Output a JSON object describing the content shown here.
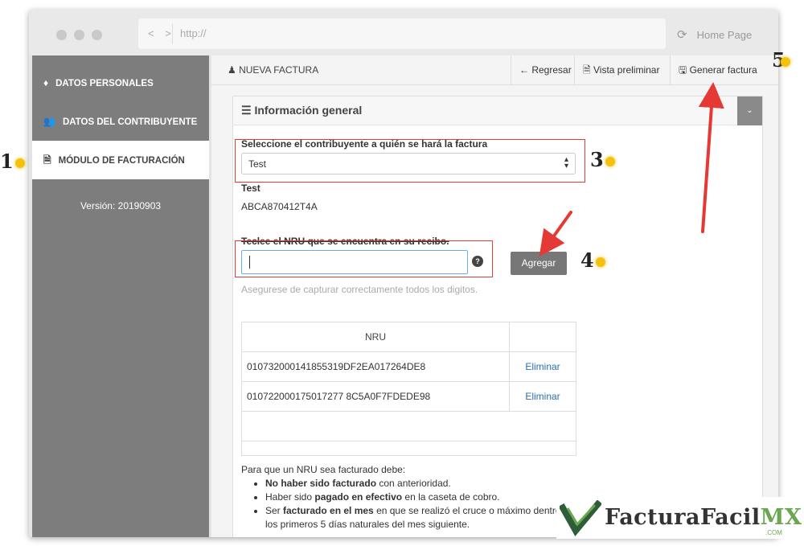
{
  "browser": {
    "url": "http://",
    "nav_arrows": "< >",
    "home_label": "Home Page",
    "reload_icon": "⟳"
  },
  "sidebar": {
    "items": [
      {
        "label": "DATOS PERSONALES",
        "icon": "person-icon",
        "glyph": "♦",
        "active": false
      },
      {
        "label": "DATOS DEL CONTRIBUYENTE",
        "icon": "group-icon",
        "glyph": "👥",
        "active": false
      },
      {
        "label": "MÓDULO DE FACTURACIÓN",
        "icon": "document-icon",
        "glyph": "🗎",
        "active": true
      }
    ],
    "version": "Versión: 20190903"
  },
  "topbar": {
    "breadcrumb": "NUEVA FACTURA",
    "back_label": "Regresar",
    "back_icon": "←",
    "preview_label": "Vista preliminar",
    "preview_icon": "🗎",
    "generate_label": "Generar factura",
    "generate_icon": "🖫"
  },
  "panel": {
    "title": "Información general",
    "menu_icon": "☰",
    "collapse_icon": "⌄"
  },
  "form": {
    "select_label": "Seleccione el contribuyente a quién se hará la factura",
    "select_value": "Test",
    "taxpayer_name": "Test",
    "taxpayer_rfc": "ABCA870412T4A",
    "nru_label": "Teclee el NRU que se encuentra en su recibo.",
    "nru_value": "",
    "help_glyph": "?",
    "add_button": "Agregar",
    "hint": "Asegurese de capturar correctamente todos los digitos."
  },
  "table": {
    "header": "NRU",
    "rows": [
      {
        "nru": "010732000141855319DF2EA017264DE8",
        "action": "Eliminar"
      },
      {
        "nru": "010722000175017277 8C5A0F7FDEDE98",
        "action": "Eliminar"
      }
    ]
  },
  "rules": {
    "intro": "Para que un NRU sea facturado debe:",
    "items": [
      {
        "bold": "No haber sido facturado",
        "rest": " con anterioridad.",
        "pre": ""
      },
      {
        "pre": "Haber sido ",
        "bold": "pagado en efectivo",
        "rest": " en la caseta de cobro."
      },
      {
        "pre": "Ser ",
        "bold": "facturado en el mes",
        "rest": " en que se realizó el cruce o máximo dentro de los primeros 5 días naturales del mes siguiente."
      }
    ]
  },
  "annotations": {
    "step1": "1",
    "step3": "3",
    "step4": "4",
    "step5": "5",
    "accent_color": "#e53935",
    "dot_color": "#f4c20d"
  },
  "logo": {
    "text": "FacturaFacil",
    "mx": "MX",
    "com": ".COM"
  }
}
